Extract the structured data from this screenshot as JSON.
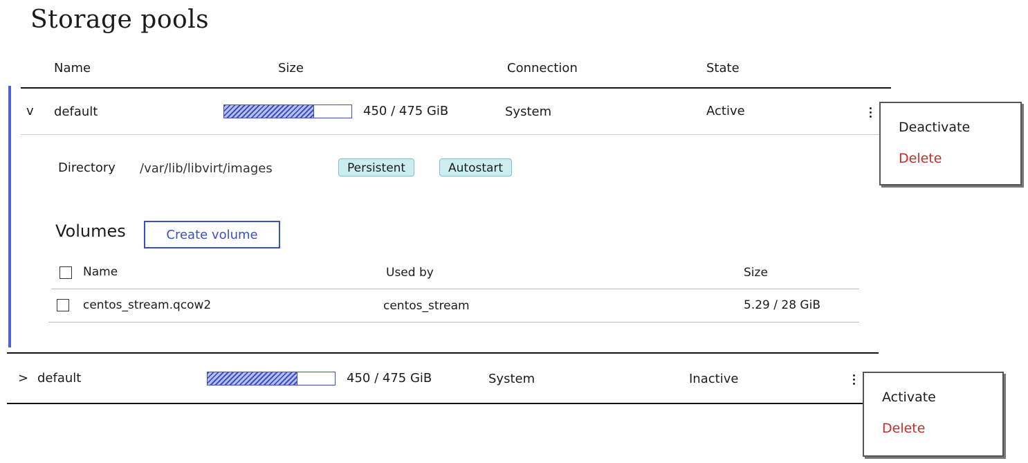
{
  "page_title": "Storage pools",
  "columns": {
    "name": "Name",
    "size": "Size",
    "connection": "Connection",
    "state": "State"
  },
  "pools": [
    {
      "name": "default",
      "expanded": true,
      "size_text": "450 / 475 GiB",
      "size_used_fraction": 0.7,
      "connection": "System",
      "state": "Active",
      "menu": {
        "primary": "Deactivate",
        "danger": "Delete"
      },
      "details": {
        "directory_label": "Directory",
        "directory_value": "/var/lib/libvirt/images",
        "tags": [
          "Persistent",
          "Autostart"
        ],
        "volumes_heading": "Volumes",
        "create_volume_label": "Create volume",
        "volume_columns": {
          "name": "Name",
          "used_by": "Used by",
          "size": "Size"
        },
        "volumes": [
          {
            "name": "centos_stream.qcow2",
            "used_by": "centos_stream",
            "size": "5.29 / 28 GiB"
          }
        ]
      }
    },
    {
      "name": "default",
      "expanded": false,
      "size_text": "450 / 475 GiB",
      "size_used_fraction": 0.7,
      "connection": "System",
      "state": "Inactive",
      "menu": {
        "primary": "Activate",
        "danger": "Delete"
      }
    }
  ],
  "icons": {
    "expanded": "chevron-down-icon",
    "collapsed": "chevron-right-icon",
    "menu": "kebab-icon"
  },
  "colors": {
    "accent": "#3a4fc4",
    "danger": "#c92a2a",
    "tag_bg": "#cdeef1"
  }
}
